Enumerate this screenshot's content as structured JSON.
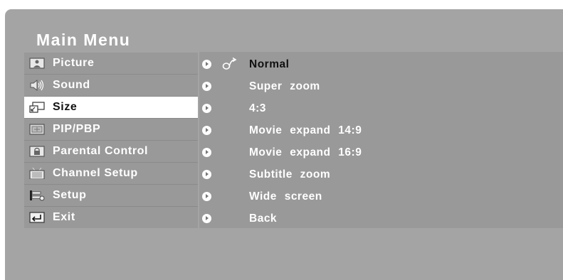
{
  "title": "Main Menu",
  "left_menu": [
    {
      "label": "Picture",
      "icon": "picture-icon"
    },
    {
      "label": "Sound",
      "icon": "speaker-icon"
    },
    {
      "label": "Size",
      "icon": "screen-size-icon",
      "selected": true
    },
    {
      "label": "PIP/PBP",
      "icon": "pip-icon"
    },
    {
      "label": "Parental Control",
      "icon": "lock-icon"
    },
    {
      "label": "Channel Setup",
      "icon": "tv-icon"
    },
    {
      "label": "Setup",
      "icon": "setup-icon"
    },
    {
      "label": "Exit",
      "icon": "exit-icon"
    }
  ],
  "size_options": [
    {
      "label": "Normal",
      "current": true
    },
    {
      "label": "Super zoom"
    },
    {
      "label": "4:3"
    },
    {
      "label": "Movie expand 14:9"
    },
    {
      "label": "Movie expand 16:9"
    },
    {
      "label": "Subtitle zoom"
    },
    {
      "label": "Wide screen"
    },
    {
      "label": "Back"
    }
  ],
  "colors": {
    "frame": "#a4a4a4",
    "panel": "#999999",
    "selected_bg": "#ffffff",
    "text": "#ffffff",
    "selected_text": "#111111"
  }
}
